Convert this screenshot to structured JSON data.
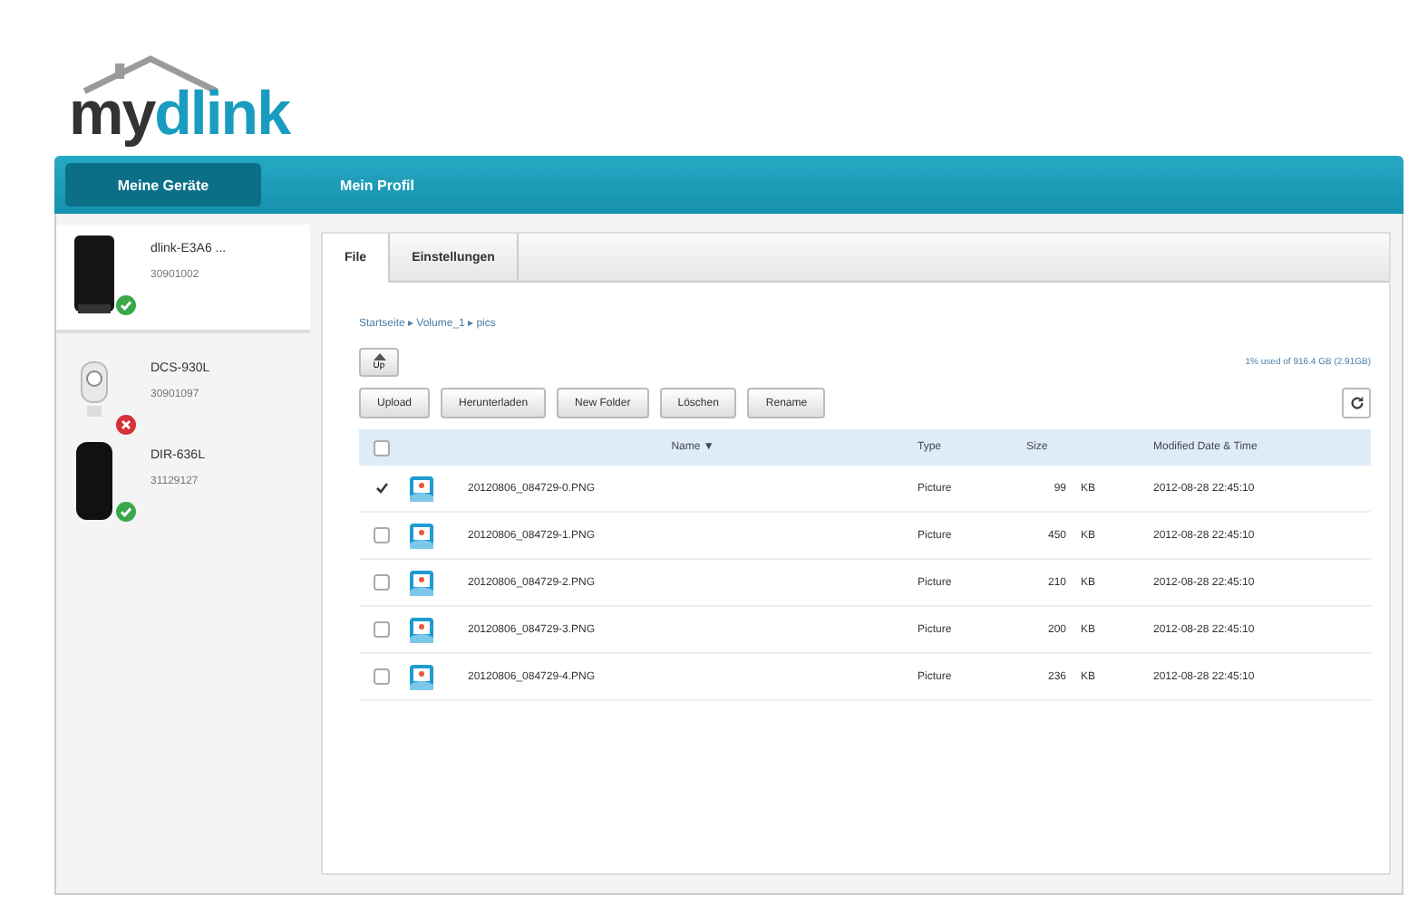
{
  "logo": {
    "text_dark": "my",
    "text_blue": "dlink"
  },
  "nav": [
    {
      "label": "Meine Geräte",
      "selected": true
    },
    {
      "label": "Mein Profil",
      "selected": false
    }
  ],
  "devices": [
    {
      "kind": "nas",
      "name": "dlink-E3A6 ...",
      "id": "30901002",
      "online": true,
      "selected": true
    },
    {
      "kind": "camera",
      "name": "DCS-930L",
      "id": "30901097",
      "online": false,
      "selected": false
    },
    {
      "kind": "router",
      "name": "DIR-636L",
      "id": "31129127",
      "online": true,
      "selected": false
    }
  ],
  "tabs": [
    {
      "label": "File",
      "selected": true
    },
    {
      "label": "Einstellungen",
      "selected": false
    }
  ],
  "breadcrumb": "Startseite ▸ Volume_1 ▸ pics",
  "up_button": "Up",
  "usage": "1% used of 916.4 GB (2.91GB)",
  "buttons": [
    "Upload",
    "Herunterladen",
    "New Folder",
    "Löschen",
    "Rename"
  ],
  "table": {
    "select_all_checked": false,
    "columns": [
      "Name ▼",
      "Type",
      "Size",
      "Modified Date & Time"
    ],
    "rows": [
      {
        "checked": true,
        "name": "20120806_084729-0.PNG",
        "type": "Picture",
        "size": "99",
        "unit": "KB",
        "modified": "2012-08-28 22:45:10"
      },
      {
        "checked": false,
        "name": "20120806_084729-1.PNG",
        "type": "Picture",
        "size": "450",
        "unit": "KB",
        "modified": "2012-08-28 22:45:10"
      },
      {
        "checked": false,
        "name": "20120806_084729-2.PNG",
        "type": "Picture",
        "size": "210",
        "unit": "KB",
        "modified": "2012-08-28 22:45:10"
      },
      {
        "checked": false,
        "name": "20120806_084729-3.PNG",
        "type": "Picture",
        "size": "200",
        "unit": "KB",
        "modified": "2012-08-28 22:45:10"
      },
      {
        "checked": false,
        "name": "20120806_084729-4.PNG",
        "type": "Picture",
        "size": "236",
        "unit": "KB",
        "modified": "2012-08-28 22:45:10"
      }
    ]
  }
}
